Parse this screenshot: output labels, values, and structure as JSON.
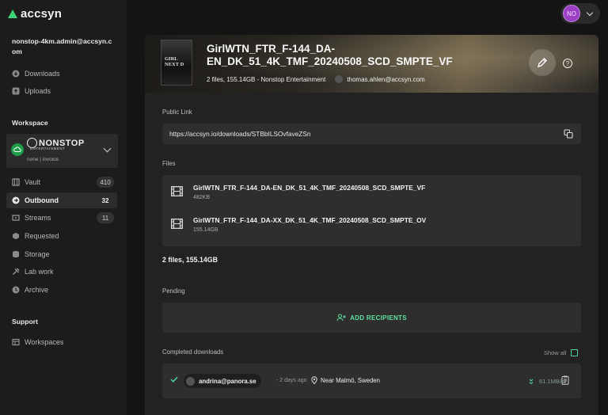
{
  "brand": {
    "name": "accsyn"
  },
  "account": {
    "email": "nonstop-4km.admin@accsyn.com"
  },
  "nav_top": [
    {
      "label": "Downloads",
      "icon": "download-icon"
    },
    {
      "label": "Uploads",
      "icon": "upload-icon"
    }
  ],
  "workspace_section": {
    "title": "Workspace"
  },
  "workspace": {
    "logo_text": "NONSTOP",
    "logo_sub": "ENTERTAINMENT",
    "meta": "none | invoice"
  },
  "nav_workspace": [
    {
      "label": "Vault",
      "badge": "410",
      "icon": "vault-icon"
    },
    {
      "label": "Outbound",
      "badge": "32",
      "icon": "outbound-icon",
      "active": true
    },
    {
      "label": "Streams",
      "badge": "11",
      "icon": "streams-icon"
    },
    {
      "label": "Requested",
      "icon": "requested-icon"
    },
    {
      "label": "Storage",
      "icon": "storage-icon"
    },
    {
      "label": "Lab work",
      "icon": "lab-icon"
    },
    {
      "label": "Archive",
      "icon": "archive-icon"
    }
  ],
  "support_section": {
    "title": "Support"
  },
  "nav_support": [
    {
      "label": "Workspaces",
      "icon": "workspaces-icon"
    }
  ],
  "user": {
    "initials": "NO"
  },
  "share": {
    "poster_text": "GIRL\nNEXT D",
    "title": "GirlWTN_FTR_F-144_DA-EN_DK_51_4K_TMF_20240508_SCD_SMPTE_VF",
    "summary": "2 files, 155.14GB",
    "sender_org": " - Nonstop Entertainment",
    "sender_email": "thomas.ahlen@accsyn.com",
    "public_link_label": "Public Link",
    "public_link": "https://accsyn.io/downloads/STBbILSOvfaveZSn",
    "files_label": "Files",
    "files": [
      {
        "name": "GirlWTN_FTR_F-144_DA-EN_DK_51_4K_TMF_20240508_SCD_SMPTE_VF",
        "size": "482KB"
      },
      {
        "name": "GirlWTN_FTR_F-144_DA-XX_DK_51_4K_TMF_20240508_SCD_SMPTE_OV",
        "size": "155.14GB"
      }
    ],
    "totals": "2 files, 155.14GB",
    "pending_label": "Pending",
    "add_recipients": "ADD RECIPIENTS",
    "completed_label": "Completed downloads",
    "show_all": "Show all",
    "downloads": [
      {
        "user": "andrina@panora.se",
        "when": "- 2 days ago",
        "location": "Near Malmö, Sweden",
        "speed": "61.1MB/s"
      }
    ]
  },
  "colors": {
    "accent": "#3ed07a",
    "link_green": "#5fe0a0",
    "avatar": "#9b3fc4"
  }
}
